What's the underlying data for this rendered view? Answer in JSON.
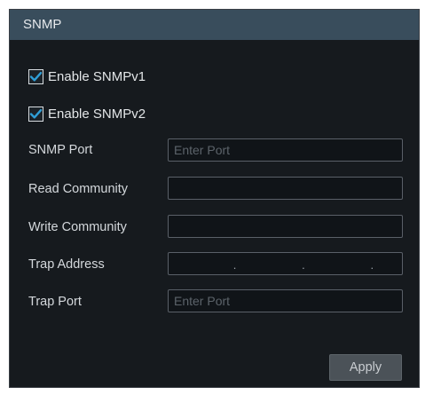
{
  "window": {
    "title": "SNMP"
  },
  "options": {
    "snmpv1": {
      "label": "Enable SNMPv1",
      "checked": true
    },
    "snmpv2": {
      "label": "Enable SNMPv2",
      "checked": true
    }
  },
  "fields": {
    "snmp_port": {
      "label": "SNMP Port",
      "value": "",
      "placeholder": "Enter Port"
    },
    "read_community": {
      "label": "Read Community",
      "value": ""
    },
    "write_community": {
      "label": "Write Community",
      "value": ""
    },
    "trap_address": {
      "label": "Trap Address",
      "separator": "."
    },
    "trap_port": {
      "label": "Trap Port",
      "value": "",
      "placeholder": "Enter Port"
    }
  },
  "buttons": {
    "apply_label": "Apply"
  },
  "icons": {
    "check": "checkmark-icon"
  },
  "colors": {
    "title_bar": "#394d5c",
    "panel_bg": "#161a1e",
    "checkbox_check": "#2f9fd8",
    "button_bg": "#4b5258"
  }
}
